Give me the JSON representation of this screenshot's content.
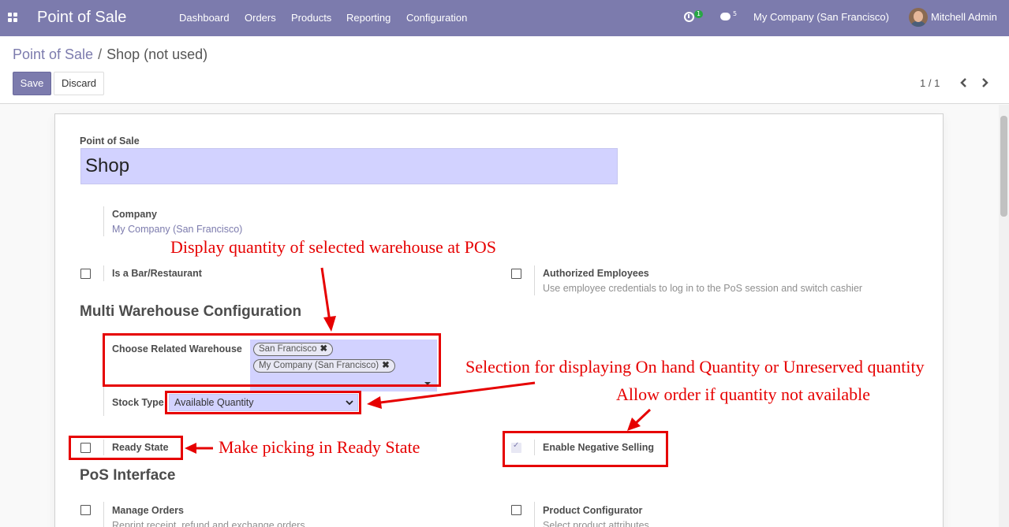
{
  "navbar": {
    "app_title": "Point of Sale",
    "menu": [
      "Dashboard",
      "Orders",
      "Products",
      "Reporting",
      "Configuration"
    ],
    "activity_count": "1",
    "messages_count": "5",
    "company": "My Company (San Francisco)",
    "user": "Mitchell Admin"
  },
  "breadcrumb": {
    "parent": "Point of Sale",
    "separator": "/",
    "current": "Shop (not used)"
  },
  "buttons": {
    "save": "Save",
    "discard": "Discard"
  },
  "pager": {
    "value": "1 / 1"
  },
  "form": {
    "name_label": "Point of Sale",
    "name_value": "Shop",
    "company_label": "Company",
    "company_value": "My Company (San Francisco)",
    "bar_label": "Is a Bar/Restaurant",
    "bar_checked": false,
    "auth_label": "Authorized Employees",
    "auth_help": "Use employee credentials to log in to the PoS session and switch cashier",
    "auth_checked": false,
    "section_multi": "Multi Warehouse Configuration",
    "warehouse_label": "Choose Related Warehouse",
    "warehouse_tags": [
      "San Francisco",
      "My Company (San Francisco)"
    ],
    "stock_type_label": "Stock Type",
    "stock_type_value": "Available Quantity",
    "ready_label": "Ready State",
    "ready_checked": false,
    "negative_label": "Enable Negative Selling",
    "negative_checked": true,
    "section_interface": "PoS Interface",
    "manage_orders_label": "Manage Orders",
    "manage_orders_help": "Reprint receipt, refund and exchange orders",
    "product_config_label": "Product Configurator",
    "product_config_help": "Select product attributes"
  },
  "annotations": {
    "display_qty": "Display quantity of selected warehouse at POS",
    "selection": "Selection for displaying On hand Quantity or Unreserved quantity",
    "allow_order": "Allow order if quantity not available",
    "ready_state": "Make picking in Ready State"
  },
  "colors": {
    "brand": "#7c7bad",
    "input_bg": "#d2d2ff",
    "annotation": "#e60000"
  }
}
